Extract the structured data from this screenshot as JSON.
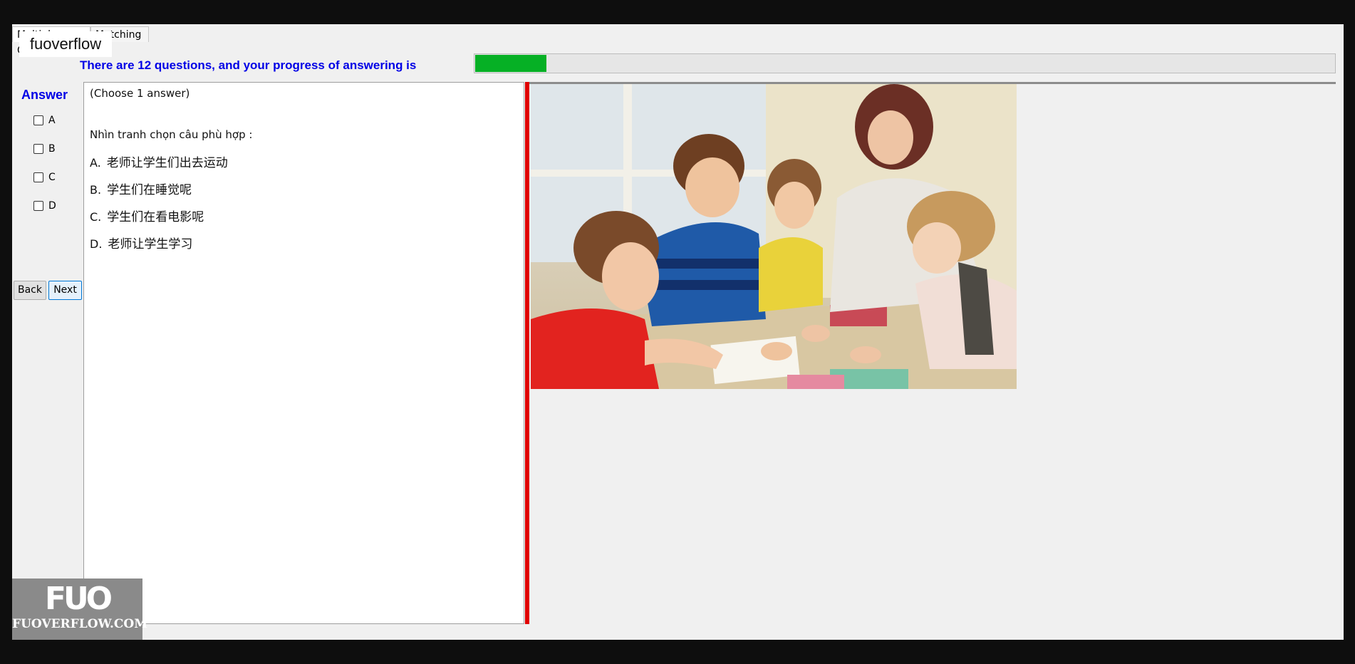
{
  "tabs": [
    {
      "label": "Multiple Choice"
    },
    {
      "label": "Matching"
    }
  ],
  "watermark_top": "fuoverflow",
  "progress": {
    "label": "There are 12 questions, and your progress of answering is",
    "fraction": 0.083,
    "fill_color": "#06b025"
  },
  "answer_panel": {
    "title": "Answer",
    "options": [
      "A",
      "B",
      "C",
      "D"
    ],
    "back_label": "Back",
    "next_label": "Next"
  },
  "question": {
    "hint": "(Choose 1 answer)",
    "prompt": "Nhìn tranh chọn câu phù hợp :",
    "choices": [
      {
        "letter": "A.",
        "text": "老师让学生们出去运动"
      },
      {
        "letter": "B.",
        "text": "学生们在睡觉呢"
      },
      {
        "letter": "C.",
        "text": "学生们在看电影呢"
      },
      {
        "letter": "D.",
        "text": "老师让学生学习"
      }
    ]
  },
  "image": {
    "alt": "teacher-with-students-photo"
  },
  "watermark_bottom": {
    "logo": "FUO",
    "site": "FUOVERFLOW.COM"
  },
  "colors": {
    "divider": "#e00000",
    "accent_text": "#0000e6"
  }
}
